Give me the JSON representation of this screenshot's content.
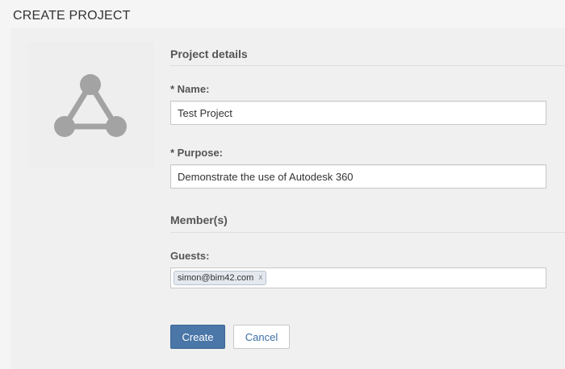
{
  "page": {
    "title": "CREATE PROJECT"
  },
  "logo": {
    "icon": "project-network-icon",
    "color": "#a3a3a3"
  },
  "project_details": {
    "heading": "Project details",
    "name_label": "* Name:",
    "name_value": "Test Project",
    "purpose_label": "* Purpose:",
    "purpose_value": "Demonstrate the use of Autodesk 360"
  },
  "members": {
    "heading": "Member(s)",
    "guests_label": "Guests:",
    "guests": [
      {
        "email": "simon@bim42.com",
        "remove_glyph": "x"
      }
    ]
  },
  "actions": {
    "create_label": "Create",
    "cancel_label": "Cancel"
  },
  "colors": {
    "primary_button": "#4a76a8",
    "link_text": "#3b6ea5"
  }
}
